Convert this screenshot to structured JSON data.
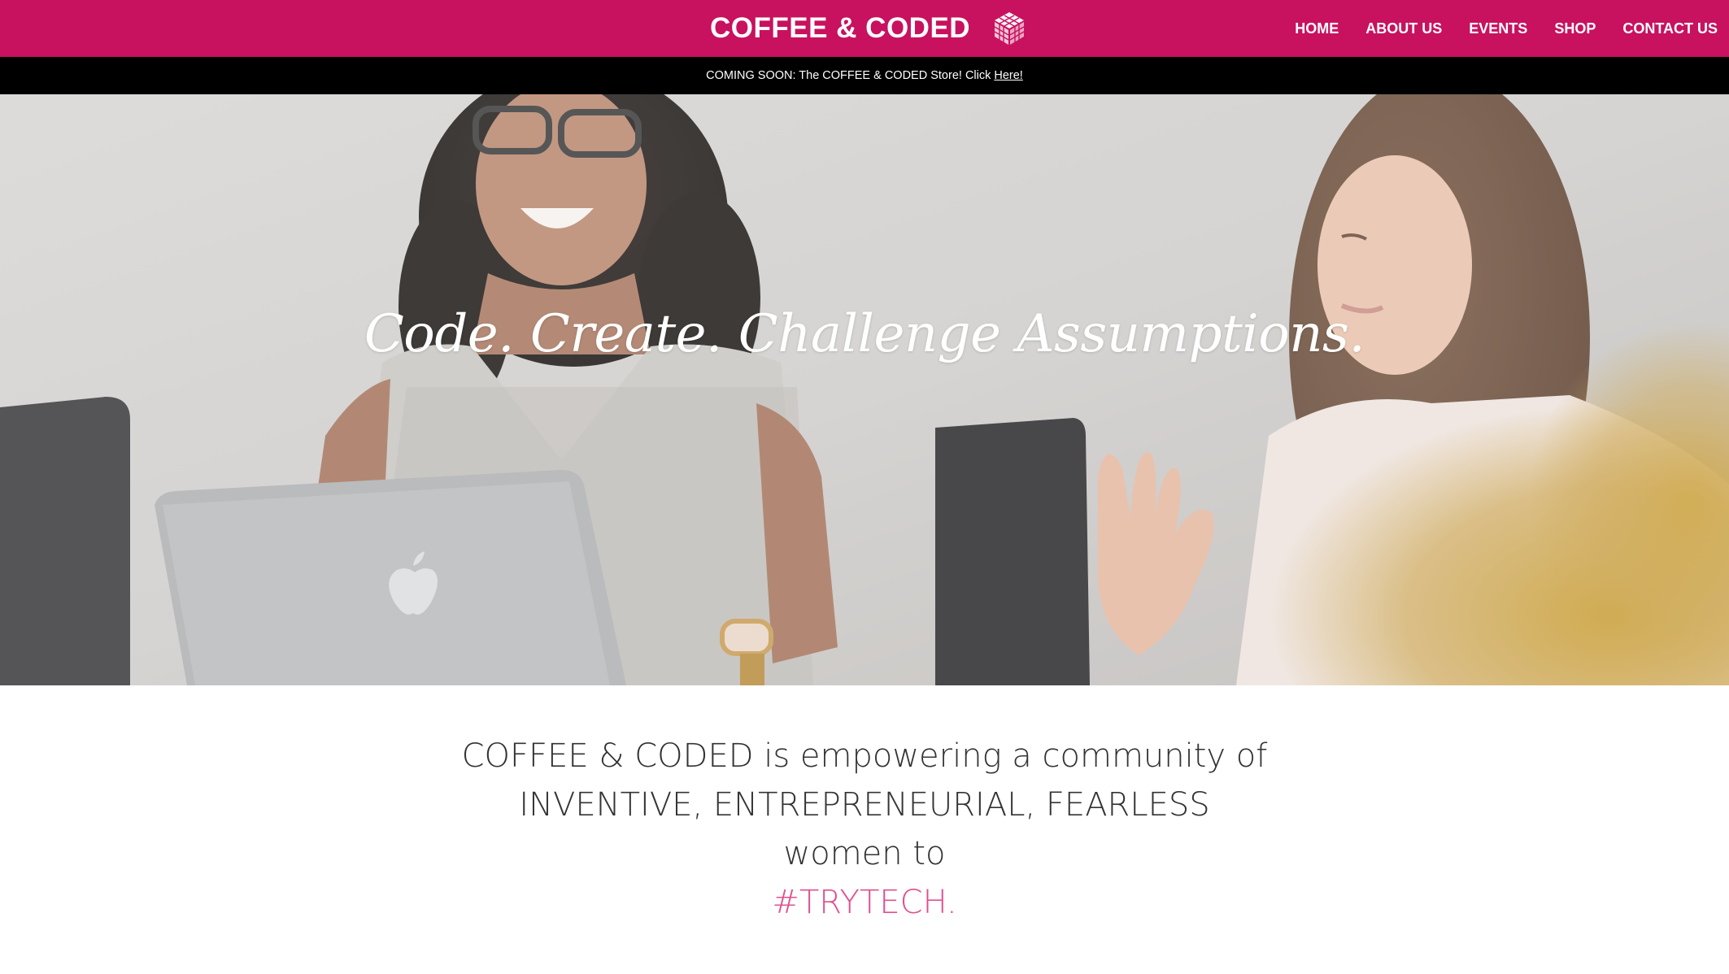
{
  "brand": {
    "name": "COFFEE & CODED",
    "accent": "#c8115f"
  },
  "nav": {
    "items": [
      "HOME",
      "ABOUT US",
      "EVENTS",
      "SHOP",
      "CONTACT US"
    ]
  },
  "announcement": {
    "text": "COMING SOON: The COFFEE & CODED Store! Click",
    "link_label": "Here!"
  },
  "hero": {
    "headline": "Code. Create. Challenge Assumptions."
  },
  "mission": {
    "line1_brand": "COFFEE & CODED",
    "line1_rest": " is empowering a community of",
    "line2": "INVENTIVE, ENTREPRENEURIAL, FEARLESS",
    "line3": "women to",
    "hashtag": "#TRYTECH.",
    "hashtag_color": "#e0508f"
  },
  "icons": [
    "cube-logo-icon",
    "apple-logo-icon"
  ]
}
